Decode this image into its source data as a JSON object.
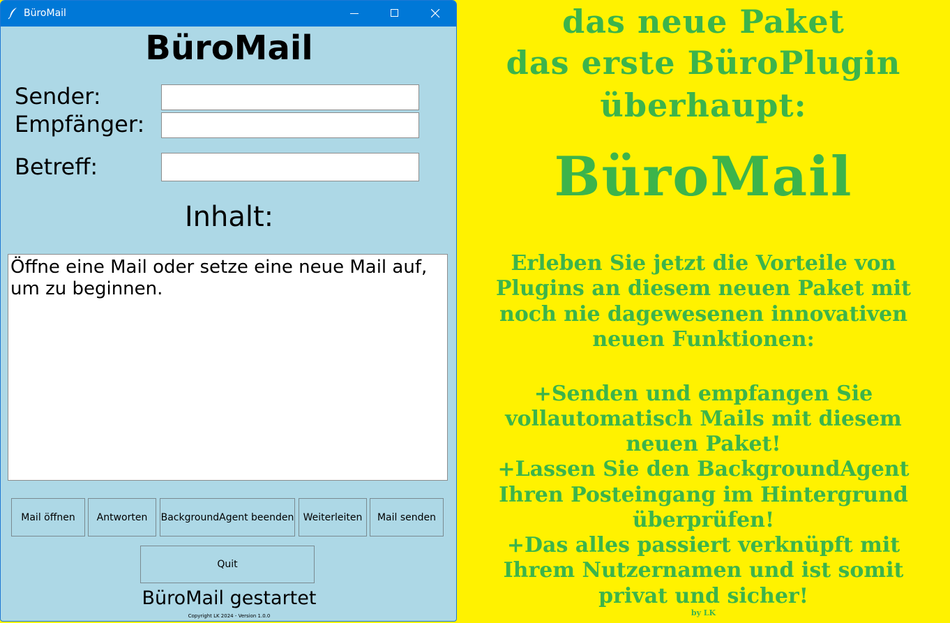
{
  "window": {
    "title": "BüroMail",
    "icon": "feather-icon",
    "controls": [
      "minimize-icon",
      "maximize-icon",
      "close-icon"
    ],
    "titlebar_color": "#0078d7",
    "background_color": "#add8e6"
  },
  "app": {
    "heading": "BüroMail",
    "labels": {
      "sender": "Sender:",
      "recipient": "Empfänger:",
      "subject": "Betreff:",
      "content": "Inhalt:"
    },
    "fields": {
      "sender": "",
      "recipient": "",
      "subject": ""
    },
    "content_text": "Öffne eine Mail oder setze eine neue Mail auf, um zu beginnen.",
    "buttons": {
      "open": "Mail öffnen",
      "reply": "Antworten",
      "stop_agent": "BackgroundAgent beenden",
      "forward": "Weiterleiten",
      "send": "Mail senden",
      "quit": "Quit"
    },
    "status": "BüroMail gestartet",
    "copyright": "Copyright LK 2024  -  Version 1.0.0"
  },
  "ad": {
    "background_color": "#fff200",
    "text_color": "#3cb44b",
    "headline": [
      "das neue Paket",
      "das erste BüroPlugin",
      "überhaupt:"
    ],
    "brand": "BüroMail",
    "intro": [
      "Erleben Sie jetzt die Vorteile von",
      "Plugins an diesem neuen Paket mit",
      "noch nie dagewesenen innovativen",
      "neuen Funktionen:"
    ],
    "features": [
      "+Senden und empfangen Sie",
      "vollautomatisch Mails mit diesem",
      "neuen Paket!",
      "+Lassen Sie den BackgroundAgent",
      "Ihren Posteingang im Hintergrund",
      "überprüfen!",
      "+Das alles passiert verknüpft mit",
      "Ihrem Nutzernamen und ist somit",
      "privat und sicher!"
    ],
    "byline": "by LK"
  }
}
